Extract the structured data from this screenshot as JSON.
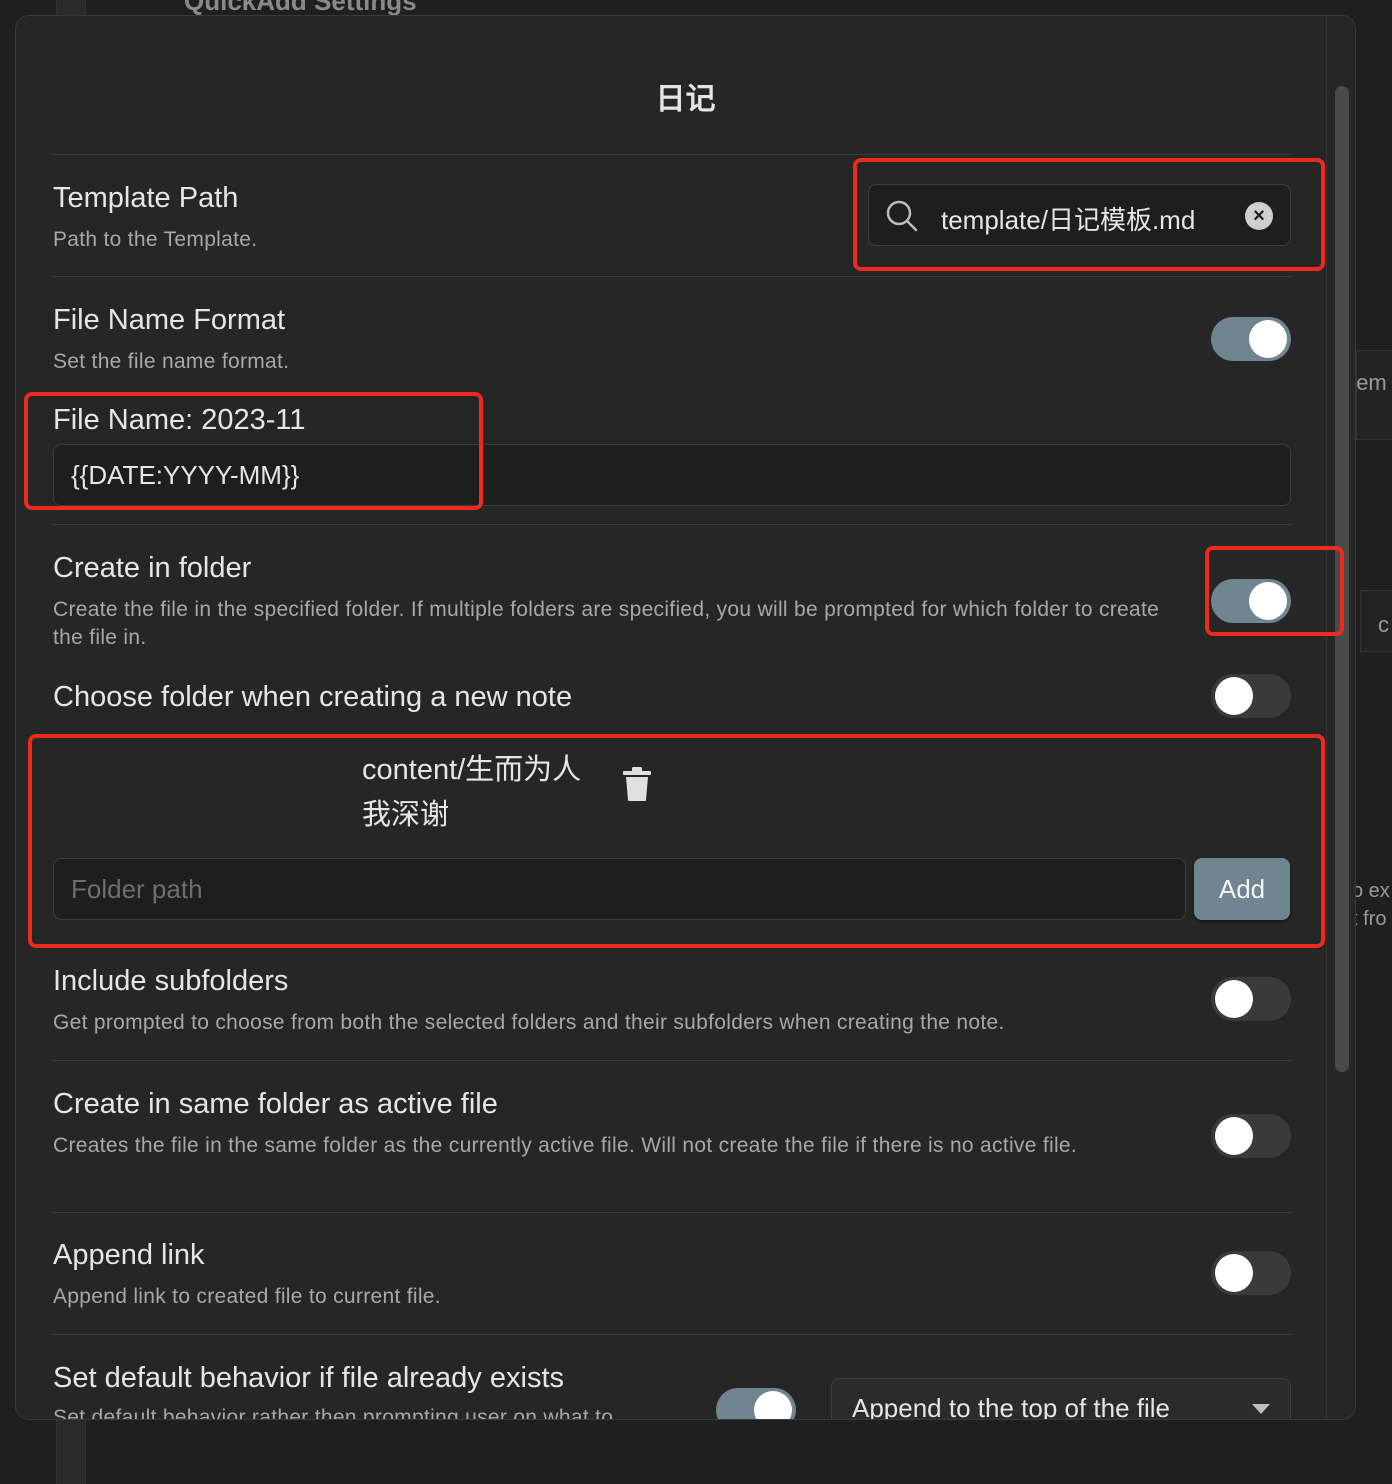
{
  "background": {
    "title": "QuickAdd Settings",
    "edge_texts": [
      "'em",
      "c",
      "o ex",
      "t fro"
    ]
  },
  "modal": {
    "title": "日记",
    "template_path": {
      "name": "Template Path",
      "desc": "Path to the Template.",
      "value": "template/日记模板.md"
    },
    "file_name_format": {
      "name": "File Name Format",
      "desc": "Set the file name format.",
      "enabled": true,
      "preview_label": "File Name: 2023-11",
      "format_value": "{{DATE:YYYY-MM}}"
    },
    "create_in_folder": {
      "name": "Create in folder",
      "desc": "Create the file in the specified folder. If multiple folders are specified, you will be prompted for which folder to create the file in.",
      "enabled": true
    },
    "choose_folder": {
      "name": "Choose folder when creating a new note",
      "enabled": false
    },
    "folders": {
      "items": [
        "content/生而为人\n我深谢"
      ],
      "input_placeholder": "Folder path",
      "add_label": "Add"
    },
    "include_subfolders": {
      "name": "Include subfolders",
      "desc": "Get prompted to choose from both the selected folders and their subfolders when creating the note.",
      "enabled": false
    },
    "same_folder": {
      "name": "Create in same folder as active file",
      "desc": "Creates the file in the same folder as the currently active file. Will not create the file if there is no active file.",
      "enabled": false
    },
    "append_link": {
      "name": "Append link",
      "desc": "Append link to created file to current file.",
      "enabled": false
    },
    "default_behavior": {
      "name": "Set default behavior if file already exists",
      "desc": "Set default behavior rather then prompting user on what to",
      "enabled": true,
      "selected": "Append to the top of the file"
    }
  },
  "colors": {
    "highlight": "#ec2a1d",
    "toggle_on": "#6f8590",
    "modal_bg": "#262626"
  }
}
